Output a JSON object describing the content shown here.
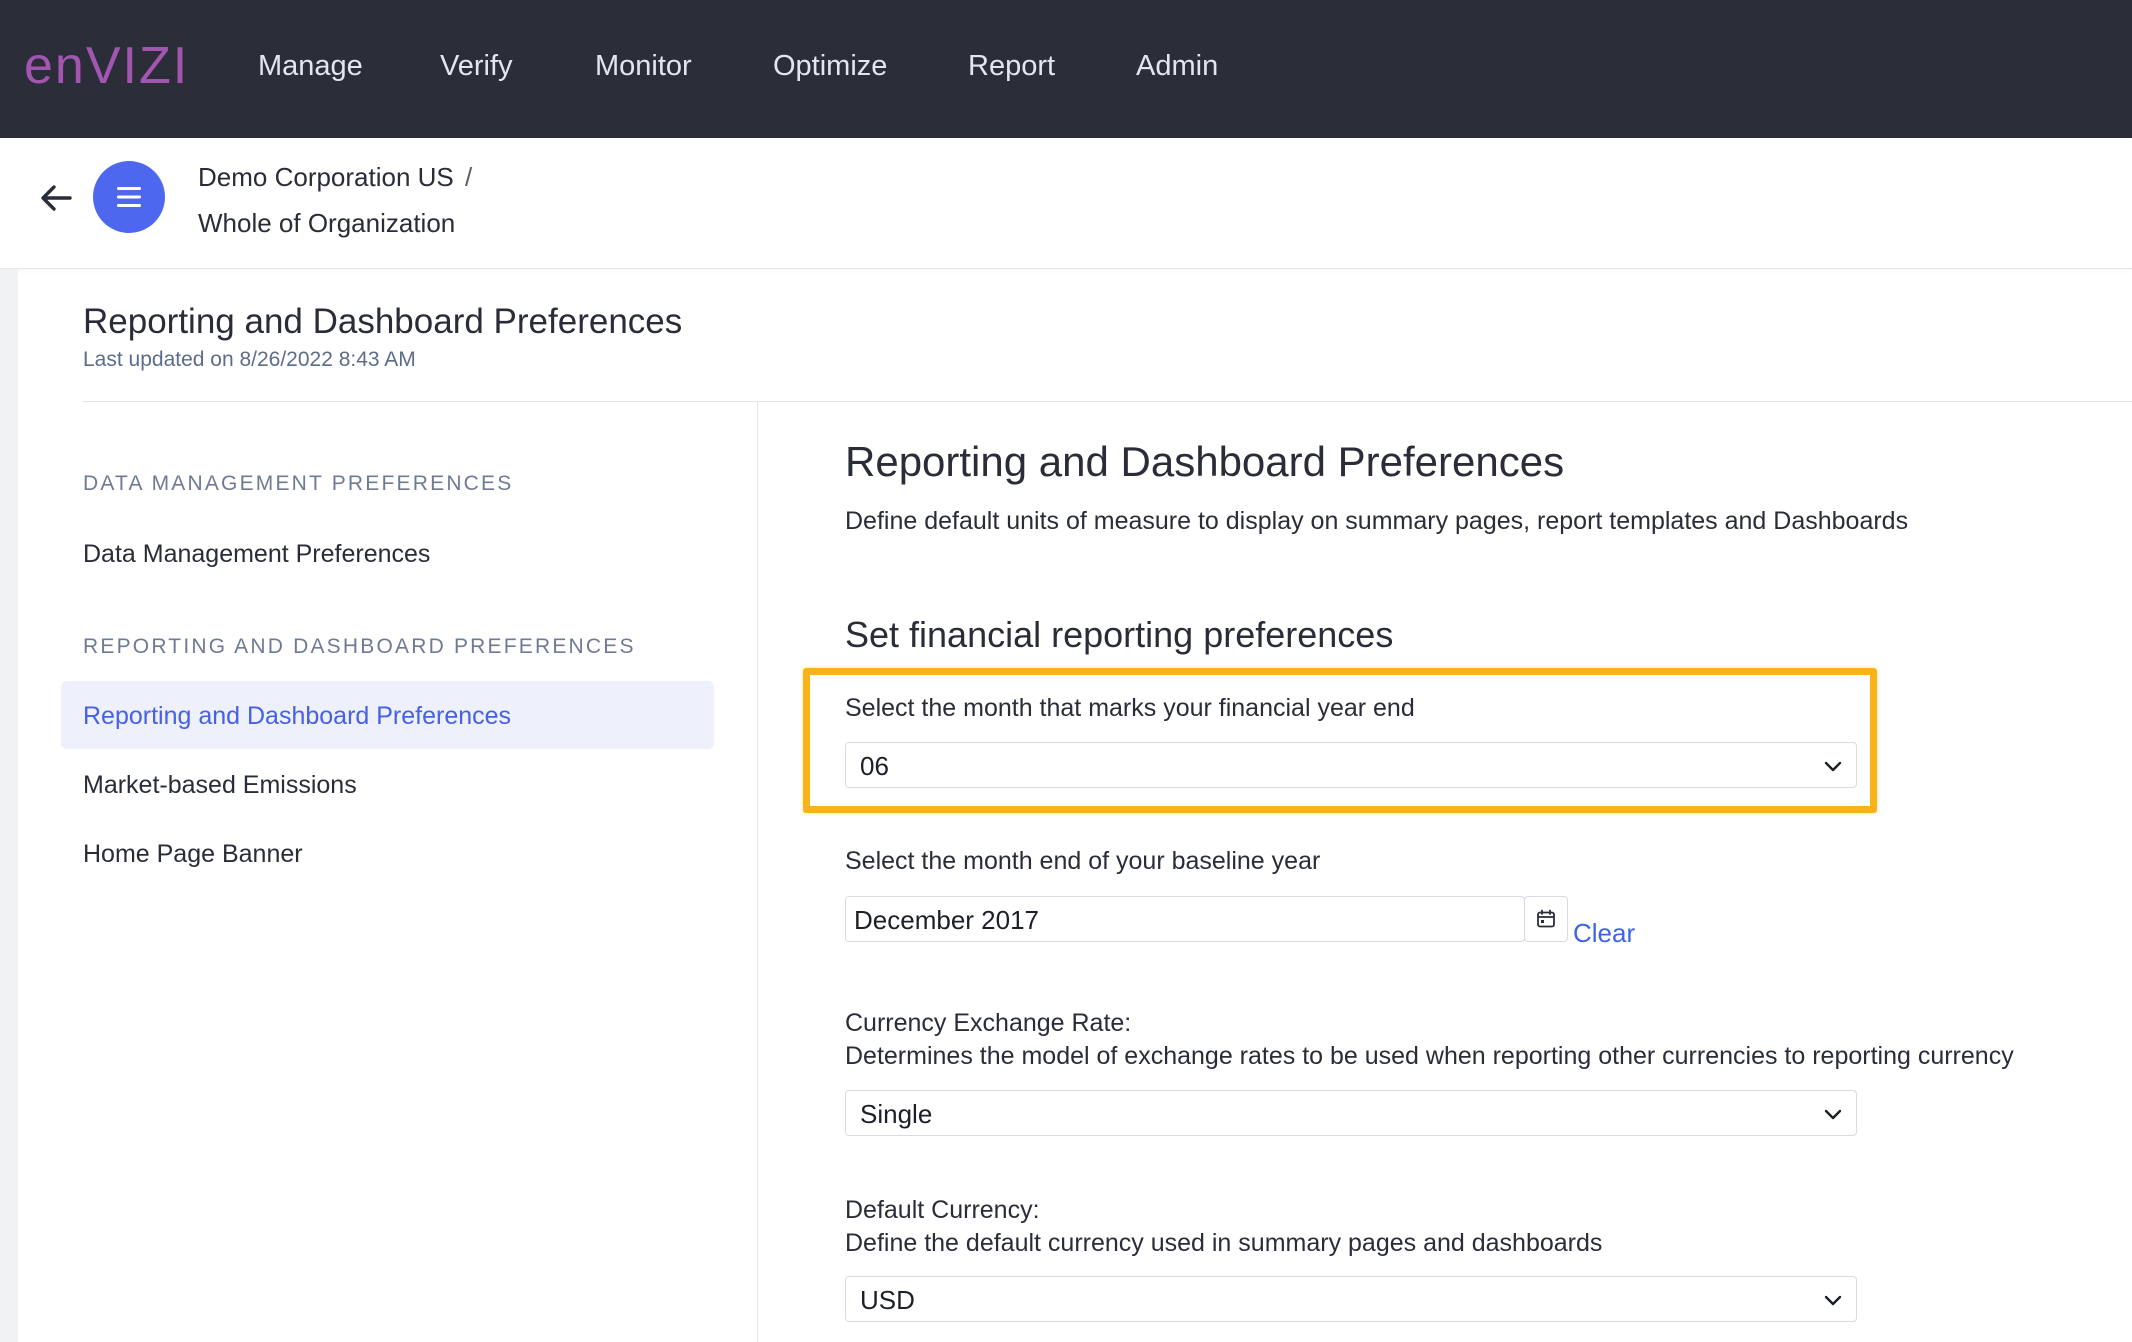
{
  "topnav": {
    "logo": "enVIZI",
    "items": [
      {
        "label": "Manage"
      },
      {
        "label": "Verify"
      },
      {
        "label": "Monitor"
      },
      {
        "label": "Optimize"
      },
      {
        "label": "Report"
      },
      {
        "label": "Admin"
      }
    ]
  },
  "context": {
    "organization": "Demo Corporation US",
    "separator": "/",
    "scope": "Whole of Organization"
  },
  "page": {
    "title": "Reporting and Dashboard Preferences",
    "updated": "Last updated on 8/26/2022 8:43 AM"
  },
  "sidebar": {
    "sections": [
      {
        "heading": "DATA MANAGEMENT PREFERENCES",
        "items": [
          {
            "label": "Data Management Preferences"
          }
        ]
      },
      {
        "heading": "REPORTING AND DASHBOARD PREFERENCES",
        "items": [
          {
            "label": "Reporting and Dashboard Preferences",
            "active": true
          },
          {
            "label": "Market-based Emissions"
          },
          {
            "label": "Home Page Banner"
          }
        ]
      }
    ]
  },
  "main": {
    "title": "Reporting and Dashboard Preferences",
    "description": "Define default units of measure to display on summary pages, report templates and Dashboards",
    "financial": {
      "heading": "Set financial reporting preferences",
      "fy_label": "Select the month that marks your financial year end",
      "fy_value": "06",
      "baseline_label": "Select the month end of your baseline year",
      "baseline_value": "December 2017",
      "clear_label": "Clear",
      "fx_label": "Currency Exchange Rate:",
      "fx_desc": "Determines the model of exchange rates to be used when reporting other currencies to reporting currency",
      "fx_value": "Single",
      "currency_label": "Default Currency:",
      "currency_desc": "Define the default currency used in summary pages and dashboards",
      "currency_value": "USD"
    }
  },
  "colors": {
    "topbar": "#2b2d39",
    "logo": "#a256b0",
    "accent": "#4d68ef",
    "highlight": "#f8b31a",
    "link": "#3e63e8"
  }
}
